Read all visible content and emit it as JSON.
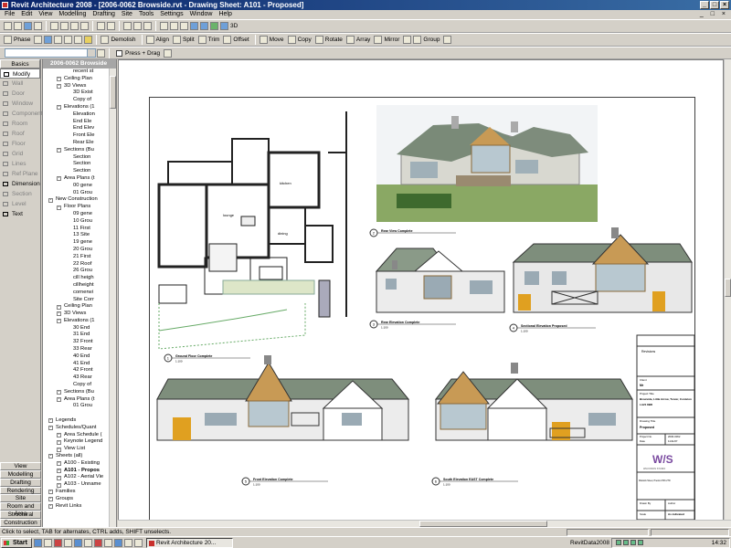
{
  "window": {
    "title": "Revit Architecture 2008 - [2006-0062 Browside.rvt - Drawing Sheet: A101 - Proposed]"
  },
  "menu": [
    "File",
    "Edit",
    "View",
    "Modelling",
    "Drafting",
    "Site",
    "Tools",
    "Settings",
    "Window",
    "Help"
  ],
  "toolbar1": {
    "view_3d_label": "3D"
  },
  "toolbar2": {
    "phase_label": "Phase",
    "move_label": "Move",
    "copy_label": "Copy",
    "rotate_label": "Rotate",
    "array_label": "Array",
    "mirror_label": "Mirror",
    "group_label": "Group",
    "demolish_label": "Demolish",
    "align_label": "Align",
    "split_label": "Split",
    "trim_label": "Trim",
    "offset_label": "Offset"
  },
  "toolbar3": {
    "press_drag_label": "Press + Drag"
  },
  "design_bar": {
    "basics_tab": "Basics",
    "tools": [
      {
        "label": "Modify",
        "enabled": true,
        "selected": true
      },
      {
        "label": "Wall",
        "enabled": false
      },
      {
        "label": "Door",
        "enabled": false
      },
      {
        "label": "Window",
        "enabled": false
      },
      {
        "label": "Component",
        "enabled": false
      },
      {
        "label": "Room",
        "enabled": false
      },
      {
        "label": "Roof",
        "enabled": false
      },
      {
        "label": "Floor",
        "enabled": false
      },
      {
        "label": "Grid",
        "enabled": false
      },
      {
        "label": "Lines",
        "enabled": false
      },
      {
        "label": "Ref Plane",
        "enabled": false
      },
      {
        "label": "Dimension",
        "enabled": true
      },
      {
        "label": "Section",
        "enabled": false
      },
      {
        "label": "Level",
        "enabled": false
      },
      {
        "label": "Text",
        "enabled": true
      }
    ],
    "bottom_tabs": [
      "View",
      "Modelling",
      "Drafting",
      "Rendering",
      "Site",
      "Room and Area",
      "Structural",
      "Construction"
    ]
  },
  "project_browser": {
    "title": "2006-0062 Browside",
    "rows": [
      {
        "text": "recent st",
        "indent": 3
      },
      {
        "text": "Ceiling Plan",
        "indent": 1
      },
      {
        "text": "3D Views",
        "indent": 1
      },
      {
        "text": "3D Exist",
        "indent": 3
      },
      {
        "text": "Copy of",
        "indent": 3
      },
      {
        "text": "Elevations (1",
        "indent": 1
      },
      {
        "text": "Elevation",
        "indent": 3
      },
      {
        "text": "End Ele",
        "indent": 3
      },
      {
        "text": "End Elev",
        "indent": 3
      },
      {
        "text": "Front Ele",
        "indent": 3
      },
      {
        "text": "Rear Ele",
        "indent": 3
      },
      {
        "text": "Sections (Bu",
        "indent": 1
      },
      {
        "text": "Section",
        "indent": 3
      },
      {
        "text": "Section",
        "indent": 3
      },
      {
        "text": "Section",
        "indent": 3
      },
      {
        "text": "Area Plans (t",
        "indent": 1
      },
      {
        "text": "00 gene",
        "indent": 3
      },
      {
        "text": "01 Grou",
        "indent": 3
      },
      {
        "text": "New Construction",
        "indent": 0
      },
      {
        "text": "Floor Plans",
        "indent": 1
      },
      {
        "text": "09 gene",
        "indent": 3
      },
      {
        "text": "10 Grou",
        "indent": 3
      },
      {
        "text": "11 First",
        "indent": 3
      },
      {
        "text": "13 Site",
        "indent": 3
      },
      {
        "text": "19 gene",
        "indent": 3
      },
      {
        "text": "20 Grou",
        "indent": 3
      },
      {
        "text": "21 First",
        "indent": 3
      },
      {
        "text": "22 Roof",
        "indent": 3
      },
      {
        "text": "26 Grou",
        "indent": 3
      },
      {
        "text": "cill heigh",
        "indent": 3
      },
      {
        "text": "cillheight",
        "indent": 3
      },
      {
        "text": "cornerwi",
        "indent": 3
      },
      {
        "text": "Site Corr",
        "indent": 3
      },
      {
        "text": "Ceiling Plan",
        "indent": 1
      },
      {
        "text": "3D Views",
        "indent": 1
      },
      {
        "text": "Elevations (1",
        "indent": 1
      },
      {
        "text": "30 End",
        "indent": 3
      },
      {
        "text": "31 End",
        "indent": 3
      },
      {
        "text": "32 Front",
        "indent": 3
      },
      {
        "text": "33 Rear",
        "indent": 3
      },
      {
        "text": "40 End",
        "indent": 3
      },
      {
        "text": "41 End",
        "indent": 3
      },
      {
        "text": "42 Front",
        "indent": 3
      },
      {
        "text": "43 Rear",
        "indent": 3
      },
      {
        "text": "Copy of",
        "indent": 3
      },
      {
        "text": "Sections (Bu",
        "indent": 1
      },
      {
        "text": "Area Plans (t",
        "indent": 1
      },
      {
        "text": "01 Grou",
        "indent": 3
      },
      {
        "text": "",
        "indent": 0
      },
      {
        "text": "Legends",
        "indent": 0
      },
      {
        "text": "Schedules/Quant",
        "indent": 0
      },
      {
        "text": "Area Schedule (",
        "indent": 1
      },
      {
        "text": "Keynote Legend",
        "indent": 1
      },
      {
        "text": "View List",
        "indent": 1
      },
      {
        "text": "Sheets (all)",
        "indent": 0
      },
      {
        "text": "A100 - Existing",
        "indent": 1
      },
      {
        "text": "A101 - Propos",
        "indent": 1,
        "bold": true
      },
      {
        "text": "A102 - Aerial Vie",
        "indent": 1
      },
      {
        "text": "A103 - Unname",
        "indent": 1
      },
      {
        "text": "Families",
        "indent": 0
      },
      {
        "text": "Groups",
        "indent": 0
      },
      {
        "text": "Revit Links",
        "indent": 0
      }
    ]
  },
  "sheet": {
    "view_titles": [
      {
        "num": "1",
        "text": "Ground Floor Complete",
        "scale": "1:100"
      },
      {
        "num": "2",
        "text": "Rear View Complete",
        "scale": ""
      },
      {
        "num": "3",
        "text": "Rear Elevation Complete",
        "scale": "1:100"
      },
      {
        "num": "4",
        "text": "Sectional Elevation Proposed",
        "scale": "1:100"
      },
      {
        "num": "5",
        "text": "Front Elevation Complete",
        "scale": "1:100"
      },
      {
        "num": "6",
        "text": "South Elevation EAST Complete",
        "scale": "1:100"
      }
    ],
    "room_labels": [
      "kitchen",
      "lounge",
      "dining"
    ],
    "title_block": {
      "revisions": "Revisions",
      "client": "Client",
      "client_name": "Mr",
      "project_title": "Project Title",
      "project_name": "Browside, Little Arrow, Torver, Coniston",
      "project_loc": "LA21 8BD",
      "drawing_title": "Drawing Title",
      "drawing_name": "Proposed",
      "project_no_label": "Project No.",
      "project_no": "2006-0062",
      "date_label": "Date",
      "date": "11/11/07",
      "drawn_label": "Drawn By",
      "drawn": "Author",
      "scale_label": "Scale",
      "scale": "As indicated",
      "logo_text": "W/S",
      "logo_sub": "WILKINSON STUDIO",
      "company_addr": "Warwick Street, Preston PR1 2TD"
    }
  },
  "status_bar": {
    "text": "Click to select, TAB for alternates, CTRL adds, SHIFT unselects."
  },
  "taskbar": {
    "start": "Start",
    "task": "Revit Architecture 20...",
    "tray_label": "RevitData2008",
    "time": "14:32"
  }
}
